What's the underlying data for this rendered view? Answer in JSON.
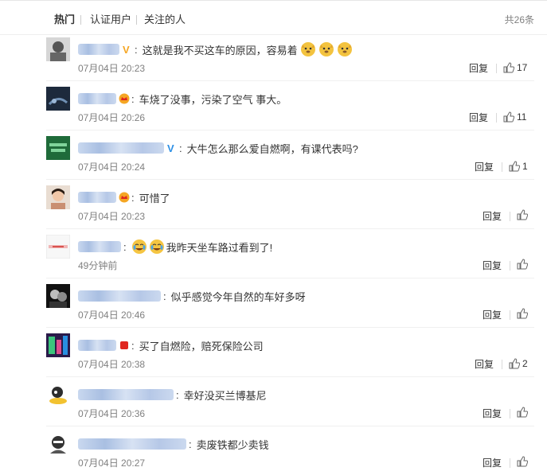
{
  "tabs": {
    "hot": "热门",
    "verified": "认证用户",
    "following": "关注的人"
  },
  "total": "共26条",
  "reply_label": "回复",
  "colors": {
    "vip_gold": "#f5a623",
    "username_blur": "#b6c8e7",
    "secondary_text": "#808080"
  },
  "comments": [
    {
      "text": "这就是我不买这车的原因，容易着",
      "time": "07月04日 20:23",
      "likes": "17",
      "badge": "v-gold-icon",
      "emojis": 3
    },
    {
      "text": "车烧了没事，污染了空气 事大。",
      "time": "07月04日 20:26",
      "likes": "11",
      "badge": "crown-icon"
    },
    {
      "text": "大牛怎么那么爱自燃啊，有课代表吗?",
      "time": "07月04日 20:24",
      "likes": "1",
      "badge": "v-blue-icon"
    },
    {
      "text": "可惜了",
      "time": "07月04日 20:23",
      "likes": "",
      "badge": "crown-icon"
    },
    {
      "text": "我昨天坐车路过看到了!",
      "time": "49分钟前",
      "likes": "",
      "badge": "",
      "emojis_before": 2
    },
    {
      "text": "似乎感觉今年自然的车好多呀",
      "time": "07月04日 20:46",
      "likes": "",
      "badge": ""
    },
    {
      "text": "买了自燃险，赔死保险公司",
      "time": "07月04日 20:38",
      "likes": "2",
      "badge": "red-tag-icon"
    },
    {
      "text": "幸好没买兰博基尼",
      "time": "07月04日 20:36",
      "likes": "",
      "badge": ""
    },
    {
      "text": "卖废铁都少卖钱",
      "time": "07月04日 20:27",
      "likes": "",
      "badge": ""
    }
  ]
}
